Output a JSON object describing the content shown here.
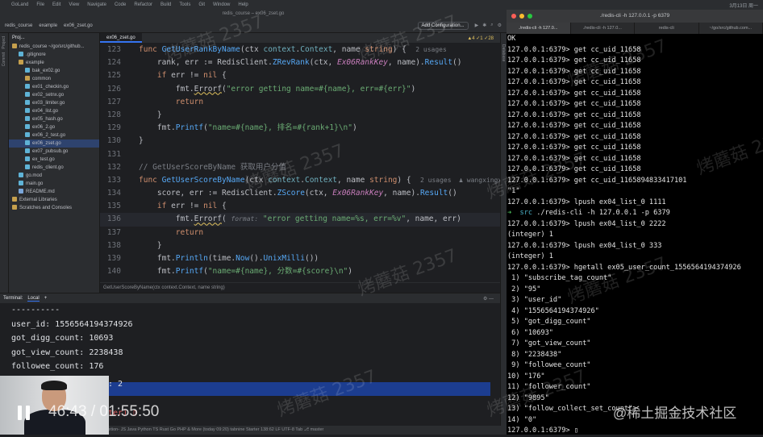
{
  "menubar": {
    "items": [
      "GoLand",
      "File",
      "Edit",
      "View",
      "Navigate",
      "Code",
      "Refactor",
      "Build",
      "Tools",
      "Git",
      "Window",
      "Help"
    ],
    "clock": "3月13日 周一"
  },
  "ide": {
    "window_title": "redis_course – ex06_zset.go",
    "breadcrumb": [
      "redis_course",
      "example",
      "ex06_zset.go"
    ],
    "add_configuration": "Add Configuration...",
    "project_label": "Proj...",
    "active_tab": "ex06_zset.go",
    "left_strip": [
      "Project",
      "Commit",
      "Structure"
    ],
    "right_strip": [
      "Database",
      "Notifications"
    ],
    "tree": [
      {
        "label": "redis_course ~/go/src/github...",
        "kind": "fold",
        "indent": 0
      },
      {
        "label": ".gitignore",
        "kind": "file",
        "indent": 1
      },
      {
        "label": "example",
        "kind": "fold",
        "indent": 1
      },
      {
        "label": "bak_ex02.go",
        "kind": "file",
        "indent": 2
      },
      {
        "label": "common",
        "kind": "fold",
        "indent": 2
      },
      {
        "label": "ex01_checkin.go",
        "kind": "file",
        "indent": 2
      },
      {
        "label": "ex02_setnx.go",
        "kind": "file",
        "indent": 2
      },
      {
        "label": "ex03_limiter.go",
        "kind": "file",
        "indent": 2
      },
      {
        "label": "ex04_list.go",
        "kind": "file",
        "indent": 2
      },
      {
        "label": "ex05_hash.go",
        "kind": "file",
        "indent": 2
      },
      {
        "label": "ex06_2.go",
        "kind": "file",
        "indent": 2
      },
      {
        "label": "ex06_2_test.go",
        "kind": "file",
        "indent": 2
      },
      {
        "label": "ex06_zset.go",
        "kind": "file",
        "indent": 2,
        "selected": true
      },
      {
        "label": "ex07_pubsub.go",
        "kind": "file",
        "indent": 2
      },
      {
        "label": "ex_test.go",
        "kind": "file",
        "indent": 2
      },
      {
        "label": "redis_client.go",
        "kind": "file",
        "indent": 2
      },
      {
        "label": "go.mod",
        "kind": "file",
        "indent": 1
      },
      {
        "label": "main.go",
        "kind": "file",
        "indent": 1
      },
      {
        "label": "README.md",
        "kind": "md",
        "indent": 1
      },
      {
        "label": "External Libraries",
        "kind": "fold",
        "indent": 0
      },
      {
        "label": "Scratches and Consoles",
        "kind": "fold",
        "indent": 0
      }
    ],
    "gutter_status": "▲4  ✓1  ✓28",
    "code": [
      {
        "n": "123",
        "html": "<span class='kw'>func</span> <span class='fn'>GetUserRankByName</span>(ctx <span class='ty'>context</span>.<span class='ty'>Context</span>, name <span class='kw'>string</span>) {  <span class='usage'>2 usages</span>"
      },
      {
        "n": "124",
        "html": "    rank, err := RedisClient.<span class='fn'>ZRevRank</span>(ctx, <span class='it'>Ex06RankKey</span>, name).<span class='fn'>Result</span>()"
      },
      {
        "n": "125",
        "html": "    <span class='kw'>if</span> err != <span class='kw'>nil</span> {"
      },
      {
        "n": "126",
        "html": "        fmt.<span class='er'>Errorf</span>(<span class='st'>\"error getting name=#{name}, err=#{err}\"</span>)"
      },
      {
        "n": "127",
        "html": "        <span class='kw'>return</span>"
      },
      {
        "n": "128",
        "html": "    }"
      },
      {
        "n": "129",
        "html": "    fmt.<span class='fn'>Printf</span>(<span class='st'>\"name=#{name}, 排名=#{rank+1}\\n\"</span>)"
      },
      {
        "n": "130",
        "html": "}"
      },
      {
        "n": "131",
        "html": ""
      },
      {
        "n": "132",
        "html": "<span class='cm'>// GetUserScoreByName 获取用户分值</span>"
      },
      {
        "n": "133",
        "html": "<span class='kw'>func</span> <span class='fn'>GetUserScoreByName</span>(ctx <span class='ty'>context</span>.<span class='ty'>Context</span>, name <span class='kw'>string</span>) {  <span class='usage'>2 usages  ♟ wangxingxing...</span>"
      },
      {
        "n": "134",
        "html": "    score, err := RedisClient.<span class='fn'>ZScore</span>(ctx, <span class='it'>Ex06RankKey</span>, name).<span class='fn'>Result</span>()"
      },
      {
        "n": "135",
        "html": "    <span class='kw'>if</span> err != <span class='kw'>nil</span> {"
      },
      {
        "n": "136",
        "html": "        fmt.<span class='er'>Errorf</span>( <span class='hint'>format:</span> <span class='st'>\"error getting name=%s, err=%v\"</span>, name, err)",
        "current": true
      },
      {
        "n": "137",
        "html": "        <span class='kw'>return</span>"
      },
      {
        "n": "138",
        "html": "    }"
      },
      {
        "n": "139",
        "html": "    fmt.<span class='fn'>Println</span>(time.<span class='fn'>Now</span>().<span class='fn'>UnixMilli</span>())"
      },
      {
        "n": "140",
        "html": "    fmt.<span class='fn'>Printf</span>(<span class='st'>\"name=#{name}, 分数=#{score}\\n\"</span>)"
      }
    ],
    "code_breadcrumb": "GetUserScoreByName(ctx context.Context, name string)",
    "terminal": {
      "label": "Terminal:",
      "tab": "Local",
      "lines": [
        "----------",
        "user_id: 1556564194374926",
        "got_digg_count: 10693",
        "got_view_count: 2238438",
        "followee_count: 176",
        "follower_count: 9895"
      ],
      "extra": "t: 2",
      "prompt_tail": "ster) ▯"
    },
    "statusbar": "pletion- JS Java Python TS Rust Go PHP & More (today 09:20)        tabnine Starter        138:62   LF   UTF-8   Tab   ⎇ master"
  },
  "video": {
    "time": "46:43 / 01:55:50"
  },
  "redis_terminal": {
    "title": "./redis-cli -h 127.0.0.1 -p 6379",
    "tabs": [
      "./redis-cli -h 127.0...",
      "./redis-cli -h 127.0...",
      "redis-cli",
      "~/go/src/github.com..."
    ],
    "lines": [
      "OK",
      "127.0.0.1:6379> get cc_uid_11658",
      "127.0.0.1:6379> get cc_uid_11658",
      "127.0.0.1:6379> get cc_uid_11658",
      "127.0.0.1:6379> get cc_uid_11658",
      "127.0.0.1:6379> get cc_uid_11658",
      "127.0.0.1:6379> get cc_uid_11658",
      "127.0.0.1:6379> get cc_uid_11658",
      "127.0.0.1:6379> get cc_uid_11658",
      "127.0.0.1:6379> get cc_uid_11658",
      "127.0.0.1:6379> get cc_uid_11658",
      "127.0.0.1:6379> get cc_uid_11658",
      "127.0.0.1:6379> get cc_uid_11658",
      "127.0.0.1:6379> get cc_uid_1165894833417101",
      "\"1\"",
      "127.0.0.1:6379> lpush ex04_list_0 1111",
      "__SRC__",
      "127.0.0.1:6379> lpush ex04_list_0 2222",
      "(integer) 1",
      "127.0.0.1:6379> lpush ex04_list_0 333",
      "(integer) 1",
      "127.0.0.1:6379> hgetall ex05_user_count_1556564194374926",
      " 1) \"subscribe_tag_count\"",
      " 2) \"95\"",
      " 3) \"user_id\"",
      " 4) \"1556564194374926\"",
      " 5) \"got_digg_count\"",
      " 6) \"10693\"",
      " 7) \"got_view_count\"",
      " 8) \"2238438\"",
      " 9) \"followee_count\"",
      "10) \"176\"",
      "11) \"follower_count\"",
      "12) \"9895\"",
      "13) \"follow_collect_set_count\"",
      "14) \"0\"",
      "127.0.0.1:6379> ▯"
    ],
    "src_arrow": "➜",
    "src_dir": "src",
    "src_cmd": "./redis-cli -h 127.0.0.1 -p 6379"
  },
  "watermark": "烤蘑菇 2357",
  "juejin": "@稀土掘金技术社区"
}
